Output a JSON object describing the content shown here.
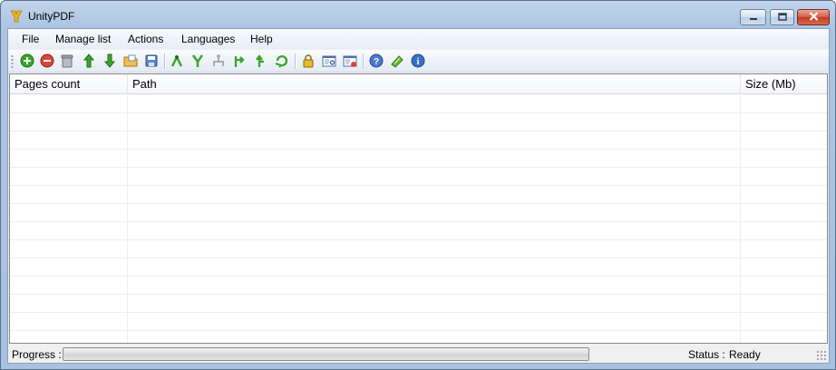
{
  "window": {
    "title": "UnityPDF",
    "minimize_icon": "minimize-icon",
    "maximize_icon": "maximize-icon",
    "close_icon": "close-icon"
  },
  "menu": {
    "items": [
      "File",
      "Manage list",
      "Actions",
      "Languages",
      "Help"
    ]
  },
  "toolbar": {
    "buttons": [
      {
        "icon": "add-icon"
      },
      {
        "icon": "remove-icon"
      },
      {
        "icon": "clear-list-icon"
      },
      {
        "icon": "move-up-icon"
      },
      {
        "icon": "move-down-icon"
      },
      {
        "icon": "open-list-icon"
      },
      {
        "icon": "save-list-icon"
      },
      {
        "icon": "merge-icon"
      },
      {
        "icon": "split-icon"
      },
      {
        "icon": "extract-icon"
      },
      {
        "icon": "insert-icon"
      },
      {
        "icon": "rotate-up-icon"
      },
      {
        "icon": "rotate-icon"
      },
      {
        "icon": "lock-icon"
      },
      {
        "icon": "properties-icon"
      },
      {
        "icon": "delete-properties-icon"
      },
      {
        "icon": "help-icon"
      },
      {
        "icon": "register-icon"
      },
      {
        "icon": "info-icon"
      }
    ]
  },
  "list": {
    "columns": [
      "Pages count",
      "Path",
      "Size (Mb)"
    ],
    "rows": []
  },
  "status": {
    "progress_label": "Progress :",
    "progress_value": 0,
    "status_label": "Status :",
    "status_value": "Ready"
  },
  "colors": {
    "accent": "#3a8f2a",
    "remove": "#d9453a",
    "info": "#3a6fc4",
    "lock": "#e0a820"
  }
}
